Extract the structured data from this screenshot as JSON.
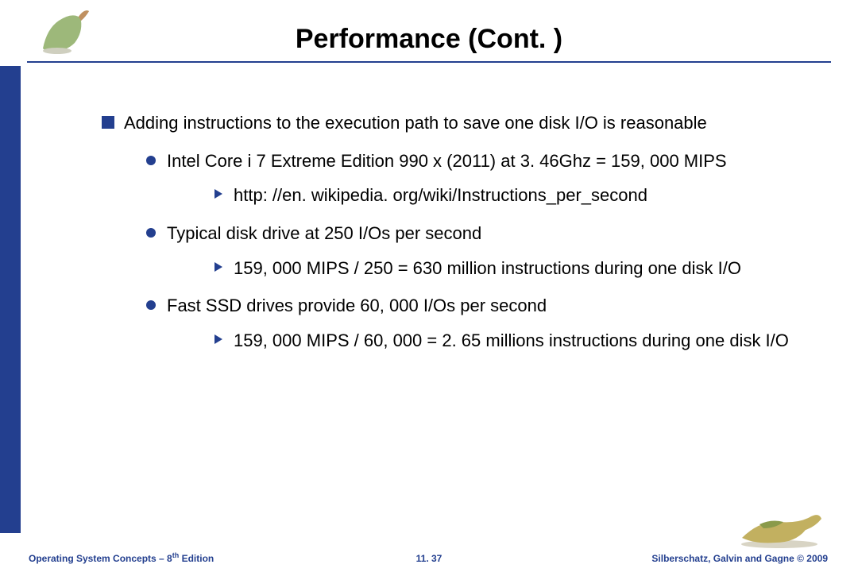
{
  "title": "Performance (Cont. )",
  "bullet1": "Adding instructions to the execution path to save one disk I/O is reasonable",
  "sub1": "Intel Core i 7 Extreme Edition 990 x (2011) at 3. 46Ghz = 159, 000 MIPS",
  "sub1a": "http: //en. wikipedia. org/wiki/Instructions_per_second",
  "sub2": "Typical disk drive at 250 I/Os per second",
  "sub2a": "159, 000 MIPS / 250 = 630 million instructions during one disk I/O",
  "sub3": "Fast SSD drives provide 60, 000 I/Os per second",
  "sub3a": "159, 000 MIPS / 60, 000 = 2. 65 millions instructions during one disk I/O",
  "footer": {
    "left_pre": "Operating System Concepts – 8",
    "left_sup": "th",
    "left_post": " Edition",
    "center": "11. 37",
    "right": "Silberschatz, Galvin and Gagne © 2009"
  }
}
